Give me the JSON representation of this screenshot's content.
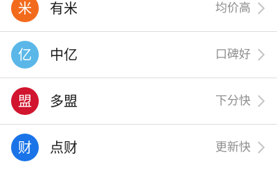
{
  "list": {
    "items": [
      {
        "icon_glyph": "米",
        "name": "有米",
        "tag": "均价高",
        "icon_color": "#f26b1d",
        "icon": "youmi-logo-icon"
      },
      {
        "icon_glyph": "亿",
        "name": "中亿",
        "tag": "口碑好",
        "icon_color": "#5ab7e8",
        "icon": "zhongyi-logo-icon"
      },
      {
        "icon_glyph": "盟",
        "name": "多盟",
        "tag": "下分快",
        "icon_color": "#d1152e",
        "icon": "duomeng-logo-icon"
      },
      {
        "icon_glyph": "财",
        "name": "点财",
        "tag": "更新快",
        "icon_color": "#1a74e8",
        "icon": "diancai-logo-icon"
      }
    ],
    "chevron_icon": "chevron-right-icon",
    "chevron_color": "#c4c4c4"
  }
}
